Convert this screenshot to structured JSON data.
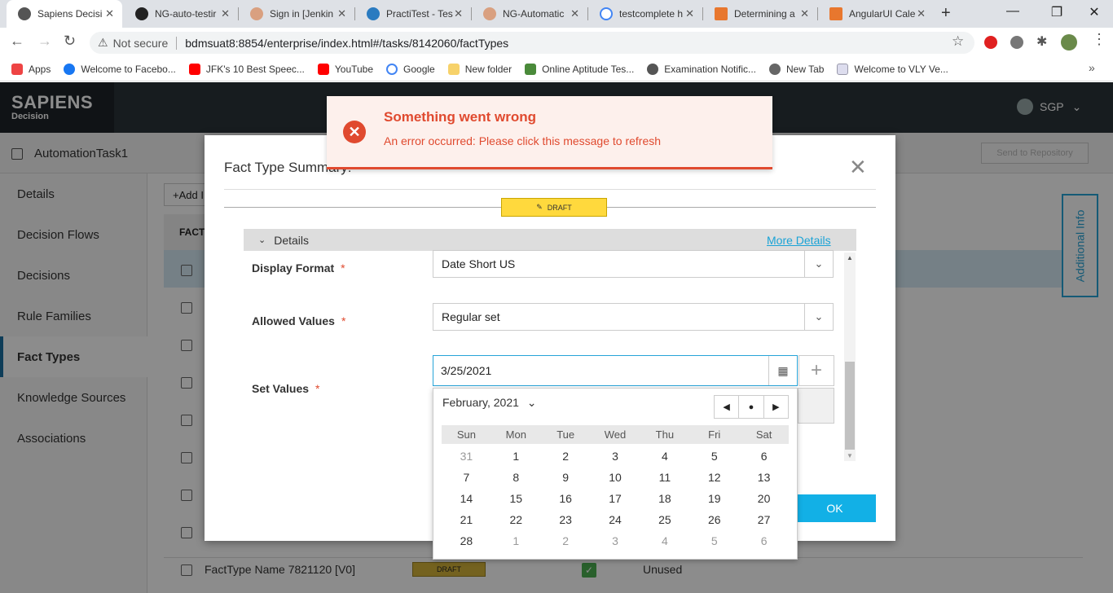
{
  "browser": {
    "tabs": [
      {
        "title": "Sapiens Decisi",
        "active": true
      },
      {
        "title": "NG-auto-testir"
      },
      {
        "title": "Sign in [Jenkin"
      },
      {
        "title": "PractiTest - Tes"
      },
      {
        "title": "NG-Automatic"
      },
      {
        "title": "testcomplete h"
      },
      {
        "title": "Determining a"
      },
      {
        "title": "AngularUI Cale"
      }
    ],
    "security_label": "Not secure",
    "url": "bdmsuat8:8854/enterprise/index.html#/tasks/8142060/factTypes",
    "bookmarks": [
      "Apps",
      "Welcome to Facebo...",
      "JFK's 10 Best Speec...",
      "YouTube",
      "Google",
      "New folder",
      "Online Aptitude Tes...",
      "Examination Notific...",
      "New Tab",
      "Welcome to VLY Ve..."
    ]
  },
  "app": {
    "logo_main": "SAPIENS",
    "logo_sub": "Decision",
    "region": "SGP",
    "task_name": "AutomationTask1",
    "send_to_repository": "Send to Repository",
    "additional_info": "Additional Info",
    "add_button": "+Add I",
    "fact_column_header": "FACT",
    "sidebar": [
      "Details",
      "Decision Flows",
      "Decisions",
      "Rule Families",
      "Fact Types",
      "Knowledge Sources",
      "Associations"
    ],
    "sidebar_active": "Fact Types",
    "bottom_row": {
      "name": "FactType Name 7821120 [V0]",
      "status": "DRAFT",
      "usage": "Unused"
    }
  },
  "modal": {
    "title": "Fact Type Summary:",
    "status_badge": "DRAFT",
    "section_title": "Details",
    "more_details": "More Details",
    "fields": {
      "display_format": {
        "label": "Display Format",
        "value": "Date Short US"
      },
      "allowed_values": {
        "label": "Allowed Values",
        "value": "Regular set"
      },
      "set_values": {
        "label": "Set Values",
        "value": "3/25/2021"
      }
    },
    "required_marker": "*",
    "ok_label": "OK"
  },
  "calendar": {
    "month_label": "February, 2021",
    "days_of_week": [
      "Sun",
      "Mon",
      "Tue",
      "Wed",
      "Thu",
      "Fri",
      "Sat"
    ],
    "weeks": [
      [
        {
          "d": "31",
          "o": true
        },
        {
          "d": "1"
        },
        {
          "d": "2"
        },
        {
          "d": "3"
        },
        {
          "d": "4"
        },
        {
          "d": "5"
        },
        {
          "d": "6"
        }
      ],
      [
        {
          "d": "7"
        },
        {
          "d": "8"
        },
        {
          "d": "9"
        },
        {
          "d": "10"
        },
        {
          "d": "11"
        },
        {
          "d": "12"
        },
        {
          "d": "13"
        }
      ],
      [
        {
          "d": "14"
        },
        {
          "d": "15"
        },
        {
          "d": "16"
        },
        {
          "d": "17"
        },
        {
          "d": "18"
        },
        {
          "d": "19"
        },
        {
          "d": "20"
        }
      ],
      [
        {
          "d": "21"
        },
        {
          "d": "22"
        },
        {
          "d": "23"
        },
        {
          "d": "24"
        },
        {
          "d": "25"
        },
        {
          "d": "26"
        },
        {
          "d": "27"
        }
      ],
      [
        {
          "d": "28"
        },
        {
          "d": "1",
          "o": true
        },
        {
          "d": "2",
          "o": true
        },
        {
          "d": "3",
          "o": true
        },
        {
          "d": "4",
          "o": true
        },
        {
          "d": "5",
          "o": true
        },
        {
          "d": "6",
          "o": true
        }
      ]
    ]
  },
  "toast": {
    "title": "Something went wrong",
    "message": "An error occurred: Please click this message to refresh",
    "color": "#e04a2f"
  },
  "colors": {
    "accent": "#12b0e6",
    "header": "#2b3339",
    "draft": "#ffd93d"
  }
}
